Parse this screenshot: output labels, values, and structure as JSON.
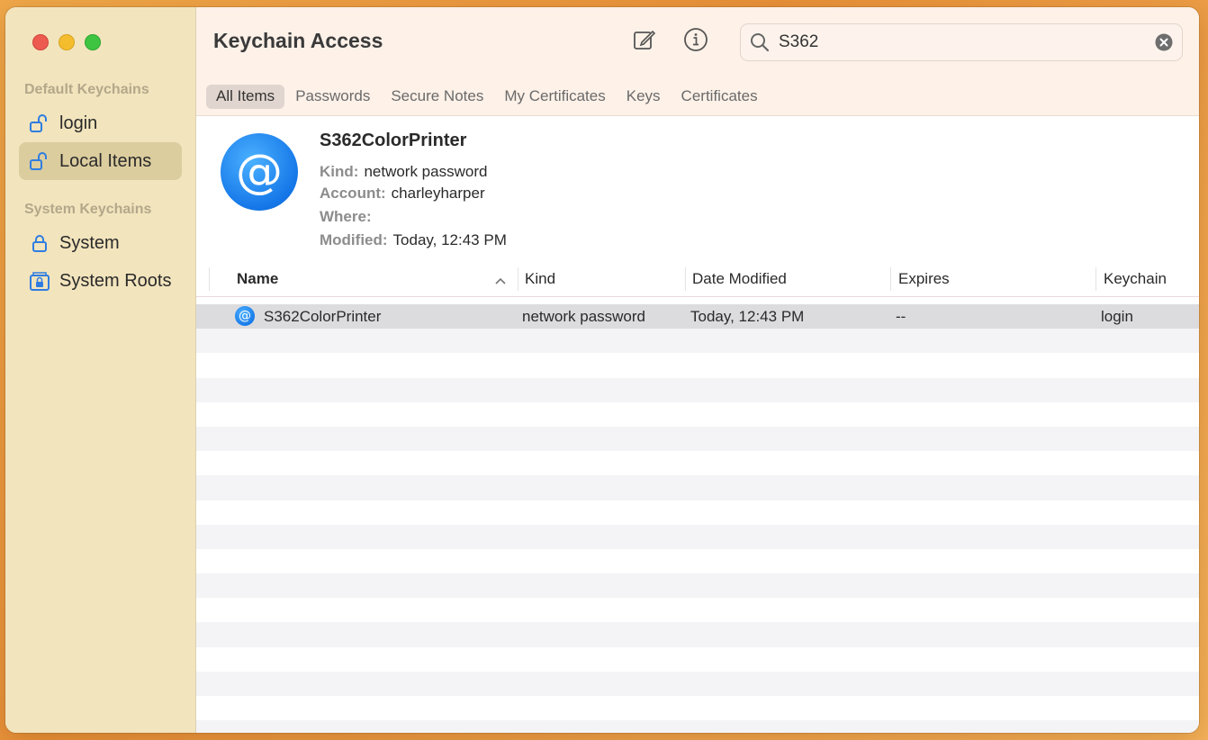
{
  "window": {
    "title": "Keychain Access"
  },
  "sidebar": {
    "default_heading": "Default Keychains",
    "system_heading": "System Keychains",
    "items": [
      {
        "label": "login",
        "icon": "unlock-icon"
      },
      {
        "label": "Local Items",
        "icon": "unlock-icon",
        "selected": true
      },
      {
        "label": "System",
        "icon": "lock-icon"
      },
      {
        "label": "System Roots",
        "icon": "lock-box-icon"
      }
    ]
  },
  "toolbar": {
    "compose_icon": "compose-icon",
    "info_icon": "info-icon"
  },
  "search": {
    "value": "S362",
    "placeholder": "Search"
  },
  "tabs": [
    {
      "label": "All Items",
      "active": true
    },
    {
      "label": "Passwords"
    },
    {
      "label": "Secure Notes"
    },
    {
      "label": "My Certificates"
    },
    {
      "label": "Keys"
    },
    {
      "label": "Certificates"
    }
  ],
  "detail": {
    "name": "S362ColorPrinter",
    "kind_label": "Kind:",
    "kind": "network password",
    "account_label": "Account:",
    "account": "charleyharper",
    "where_label": "Where:",
    "where": "",
    "modified_label": "Modified:",
    "modified": "Today, 12:43 PM"
  },
  "table": {
    "columns": [
      "Name",
      "Kind",
      "Date Modified",
      "Expires",
      "Keychain"
    ],
    "sort_indicator": "^",
    "rows": [
      {
        "name": "S362ColorPrinter",
        "kind": "network password",
        "date": "Today, 12:43 PM",
        "expires": "--",
        "keychain": "login"
      }
    ]
  }
}
